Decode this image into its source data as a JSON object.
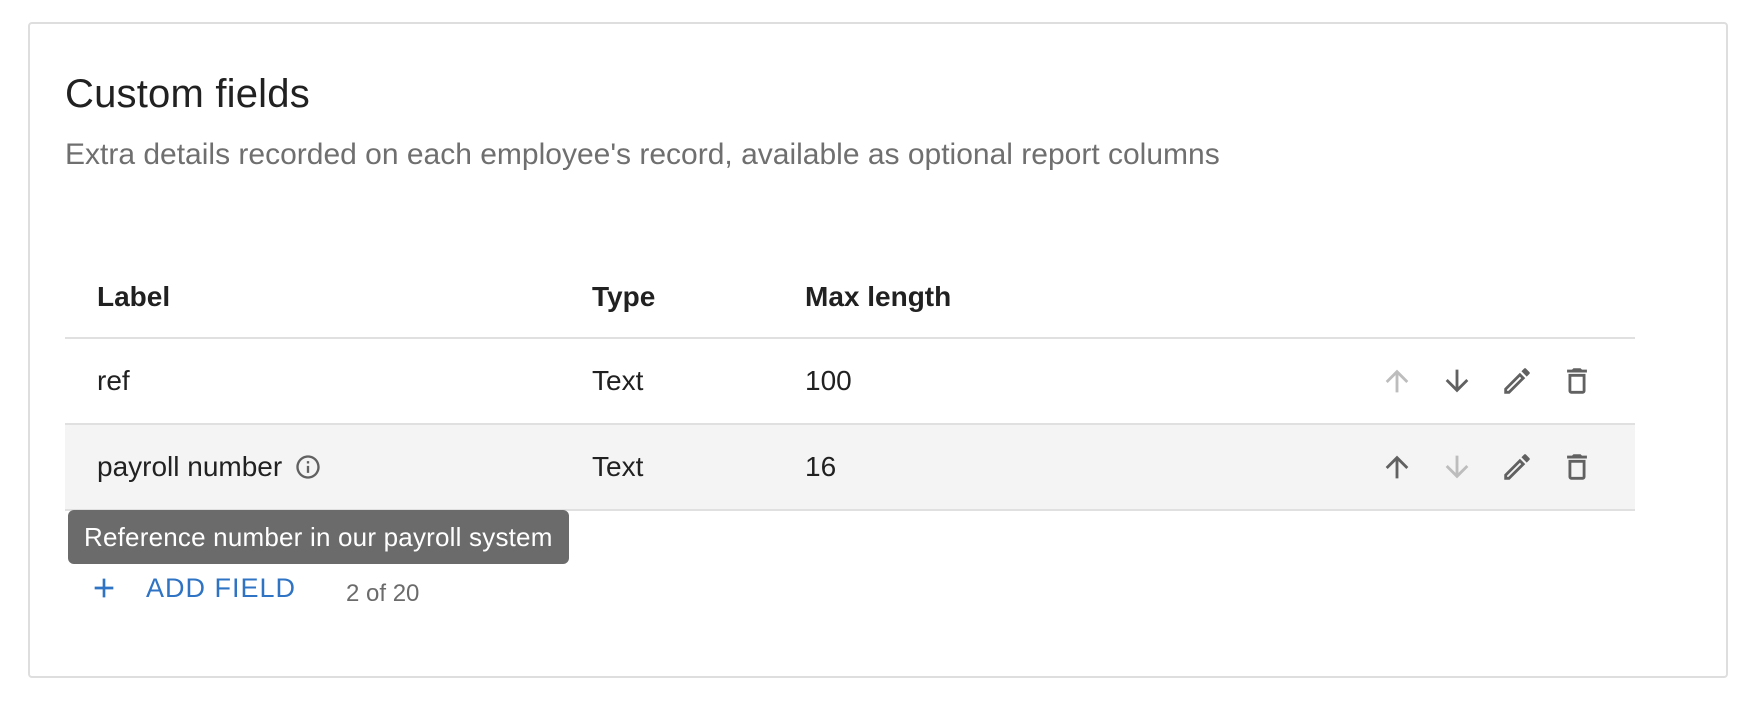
{
  "section": {
    "title": "Custom fields",
    "description": "Extra details recorded on each employee's record, available as optional report columns"
  },
  "table": {
    "columns": [
      "Label",
      "Type",
      "Max length"
    ],
    "rows": [
      {
        "label": "ref",
        "type": "Text",
        "max_length": "100",
        "has_info": false
      },
      {
        "label": "payroll number",
        "type": "Text",
        "max_length": "16",
        "has_info": true
      }
    ]
  },
  "tooltip": {
    "text": "Reference number in our payroll system"
  },
  "footer": {
    "add_label": "ADD FIELD",
    "count_text": "2 of 20"
  },
  "colors": {
    "accent": "#2f73c4",
    "icon": "#616161",
    "icon_disabled": "#bdbdbd",
    "tooltip_bg": "#6b6b6b",
    "row_highlight": "#f4f4f4"
  },
  "icons": {
    "row_actions": [
      "arrow-up-icon",
      "arrow-down-icon",
      "pencil-icon",
      "trash-icon"
    ],
    "info": "info-icon",
    "add": "plus-icon"
  }
}
